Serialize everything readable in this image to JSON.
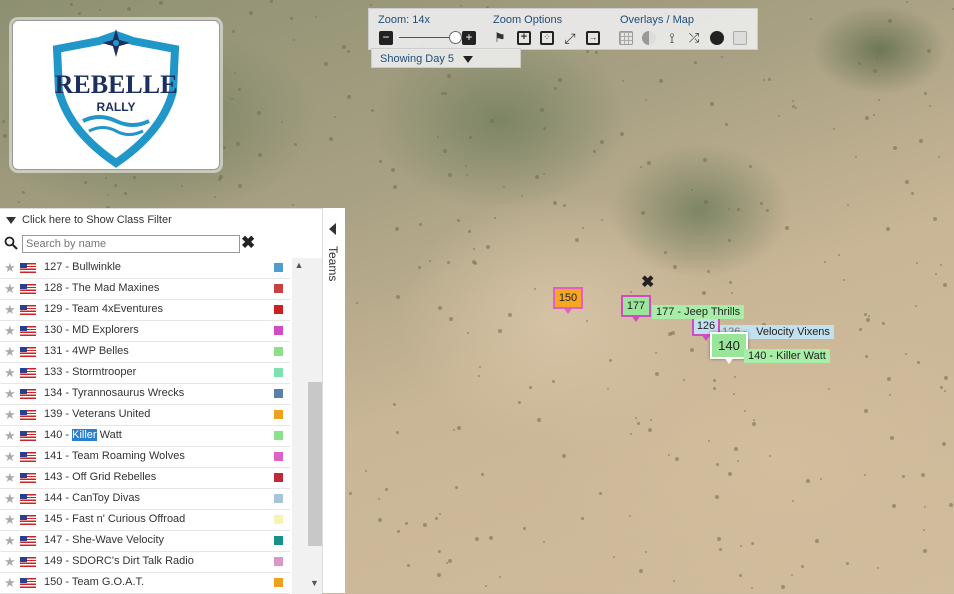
{
  "logo": {
    "brand": "REBELLE",
    "subtitle": "RALLY",
    "colors": {
      "blue": "#2196c9",
      "navy": "#1c2f5e"
    }
  },
  "toolbar": {
    "zoom_label": "Zoom: 14x",
    "zoom_options_label": "Zoom Options",
    "overlays_label": "Overlays / Map",
    "day_select": "Showing Day 5",
    "zoom_buttons": [
      "zoom-out-icon",
      "zoom-in-icon"
    ],
    "zoom_option_icons": [
      "checkered-flag-icon",
      "plus-box-icon",
      "dice-icon",
      "expand-icon",
      "arrow-box-icon"
    ],
    "overlay_icons": [
      "grid-icon",
      "contrast-icon",
      "route-icon",
      "shuffle-icon",
      "globe-icon",
      "square-icon"
    ]
  },
  "panel": {
    "filter_text": "Click here to Show Class Filter",
    "search_placeholder": "Search by name",
    "teams_tab": "Teams",
    "teams": [
      {
        "name": "127 - Bullwinkle",
        "color": "#4e9ed1"
      },
      {
        "name": "128 - The Mad Maxines",
        "color": "#c94040"
      },
      {
        "name": "129 - Team 4xEventures",
        "color": "#cc1f1f"
      },
      {
        "name": "130 - MD Explorers",
        "color": "#d24bc3"
      },
      {
        "name": "131 - 4WP Belles",
        "color": "#8de08a"
      },
      {
        "name": "133 - Stormtrooper",
        "color": "#7fe0b0"
      },
      {
        "name": "134 - Tyrannosaurus Wrecks",
        "color": "#5b7fa8"
      },
      {
        "name": "139 - Veterans United",
        "color": "#f0a020"
      },
      {
        "name_prefix": "140 - ",
        "name_highlight": "Killer",
        "name_suffix": " Watt",
        "color": "#8de08a"
      },
      {
        "name": "141 - Team Roaming Wolves",
        "color": "#e060c8"
      },
      {
        "name": "143 - Off Grid Rebelles",
        "color": "#c0283a"
      },
      {
        "name": "144 - CanToy Divas",
        "color": "#a7c4d8"
      },
      {
        "name": "145 - Fast n' Curious Offroad",
        "color": "#f7f3b0"
      },
      {
        "name": "147 - She-Wave Velocity",
        "color": "#1a8f8a"
      },
      {
        "name": "149 - SDORC's Dirt Talk Radio",
        "color": "#d898c8"
      },
      {
        "name": "150 - Team G.O.A.T.",
        "color": "#f0a020"
      }
    ]
  },
  "map": {
    "markers": [
      {
        "label": "150",
        "color": "#f5a623",
        "border": "#e060c8"
      },
      {
        "label": "177",
        "color": "#9ae59a",
        "border": "#d24bc3",
        "tag": "177 - Jeep Thrills",
        "tag_color": "#a8eea8"
      },
      {
        "label": "126",
        "color": "#c3e0ee",
        "border": "#d24bc3",
        "tag": "126 - Velocity Vixens",
        "tag_color": "#c3e0ee"
      },
      {
        "label": "140",
        "color": "#9ae59a",
        "border": "#ffffff",
        "tag": "140 - Killer Watt",
        "tag_color": "#a8eea8"
      }
    ],
    "tag_126_visible": "Velocity Vixens",
    "tag_126_partial": "126 -"
  }
}
